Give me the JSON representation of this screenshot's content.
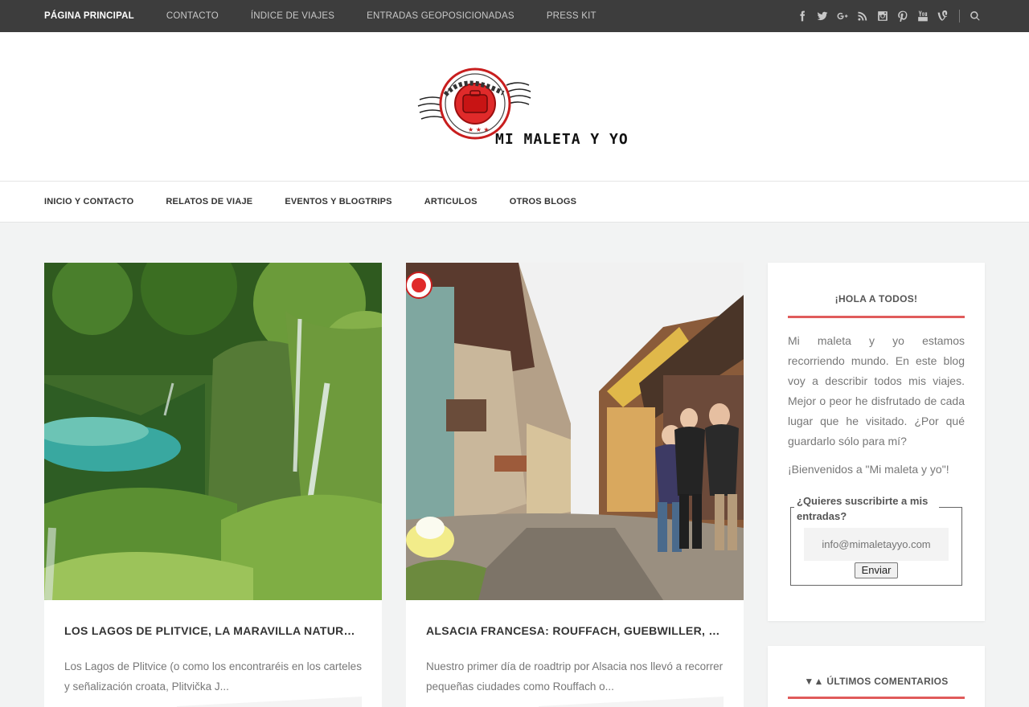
{
  "topbar": {
    "links": [
      "Página principal",
      "Contacto",
      "Índice de viajes",
      "Entradas geoposicionadas",
      "Press Kit"
    ],
    "social_icons": [
      "facebook-icon",
      "twitter-icon",
      "google-plus-icon",
      "rss-icon",
      "instagram-icon",
      "pinterest-icon",
      "youtube-icon",
      "vine-icon"
    ]
  },
  "header": {
    "logo_stamp_text": "MI MALETA Y YO",
    "logo_text": "MI MALETA Y YO"
  },
  "mainnav": {
    "items": [
      "Inicio y contacto",
      "Relatos de viaje",
      "Eventos y blogtrips",
      "Articulos",
      "Otros blogs"
    ]
  },
  "posts": [
    {
      "title": "Los Lagos de Plitvice, la maravilla natural de Croacia",
      "excerpt": "Los Lagos de Plitvice (o como los encontraréis en los carteles y señalización croata, Plitvička J..."
    },
    {
      "title": "Alsacia francesa: Rouffach, Guebwiller, Eguisheim",
      "excerpt": "Nuestro primer día de roadtrip por Alsacia nos llevó a recorrer pequeñas ciudades como Rouffach o..."
    }
  ],
  "sidebar": {
    "welcome_widget": {
      "title": "¡Hola a todos!",
      "about": "Mi maleta y yo estamos recorriendo mundo. En este blog voy a describir todos mis viajes. Mejor o peor he disfrutado de cada lugar que he visitado. ¿Por qué guardarlo sólo para mí?",
      "welcome": "¡Bienvenidos a \"Mi maleta y yo\"!",
      "subscribe_label": "¿Quieres suscribirte a mis entradas?",
      "email_placeholder": "info@mimaletayyo.com",
      "submit_label": "Enviar"
    },
    "comments_widget": {
      "title": "▼▲ Últimos comentarios"
    }
  },
  "colors": {
    "accent": "#e05b5b",
    "topbar": "#3d3d3d"
  }
}
